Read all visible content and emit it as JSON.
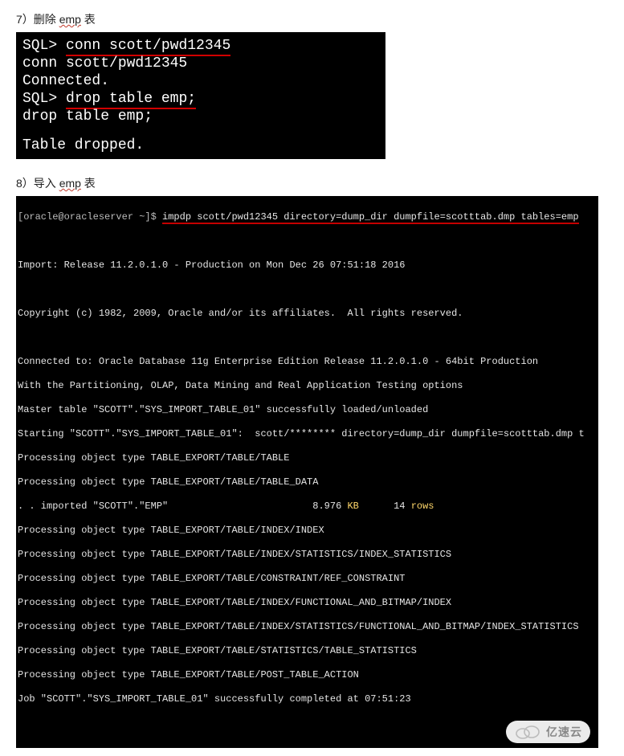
{
  "step7": {
    "title_prefix": "7）",
    "title_action": "删除 ",
    "title_object": "emp",
    "title_suffix": " 表",
    "lines": {
      "l1_prompt": "SQL> ",
      "l1_cmd": "conn scott/pwd12345",
      "l2": "conn scott/pwd12345",
      "l3": "Connected.",
      "l4_prompt": "SQL> ",
      "l4_cmd": "drop table emp;",
      "l5": "drop table emp;",
      "l6": "Table dropped."
    }
  },
  "step8": {
    "title_prefix": "8）",
    "title_action": "导入 ",
    "title_object": "emp",
    "title_suffix": " 表",
    "prompt": "[oracle@oracleserver ~]$ ",
    "cmd": "impdp scott/pwd12345 directory=dump_dir dumpfile=scotttab.dmp tables=emp",
    "out": {
      "o1": "Import: Release 11.2.0.1.0 - Production on Mon Dec 26 07:51:18 2016",
      "o2": "Copyright (c) 1982, 2009, Oracle and/or its affiliates.  All rights reserved.",
      "o3": "Connected to: Oracle Database 11g Enterprise Edition Release 11.2.0.1.0 - 64bit Production",
      "o4": "With the Partitioning, OLAP, Data Mining and Real Application Testing options",
      "o5": "Master table \"SCOTT\".\"SYS_IMPORT_TABLE_01\" successfully loaded/unloaded",
      "o6": "Starting \"SCOTT\".\"SYS_IMPORT_TABLE_01\":  scott/******** directory=dump_dir dumpfile=scotttab.dmp t",
      "o7": "Processing object type TABLE_EXPORT/TABLE/TABLE",
      "o8": "Processing object type TABLE_EXPORT/TABLE/TABLE_DATA",
      "o9a": ". . imported \"SCOTT\".\"EMP\"                         8.976 ",
      "o9kb": "KB",
      "o9b": "      14 ",
      "o9rows": "rows",
      "o10": "Processing object type TABLE_EXPORT/TABLE/INDEX/INDEX",
      "o11": "Processing object type TABLE_EXPORT/TABLE/INDEX/STATISTICS/INDEX_STATISTICS",
      "o12": "Processing object type TABLE_EXPORT/TABLE/CONSTRAINT/REF_CONSTRAINT",
      "o13": "Processing object type TABLE_EXPORT/TABLE/INDEX/FUNCTIONAL_AND_BITMAP/INDEX",
      "o14": "Processing object type TABLE_EXPORT/TABLE/INDEX/STATISTICS/FUNCTIONAL_AND_BITMAP/INDEX_STATISTICS",
      "o15": "Processing object type TABLE_EXPORT/TABLE/STATISTICS/TABLE_STATISTICS",
      "o16": "Processing object type TABLE_EXPORT/TABLE/POST_TABLE_ACTION",
      "o17": "Job \"SCOTT\".\"SYS_IMPORT_TABLE_01\" successfully completed at 07:51:23"
    }
  },
  "watermark": {
    "text": "亿速云"
  }
}
